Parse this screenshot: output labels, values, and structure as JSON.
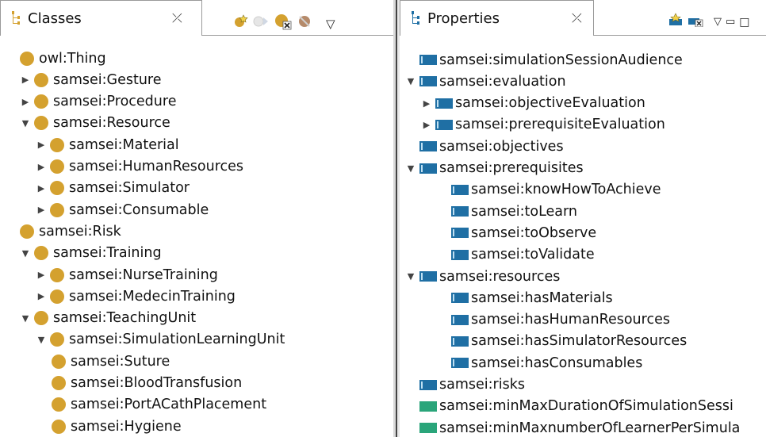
{
  "classes_view": {
    "title": "Classes",
    "close_glyph": "⤫",
    "toolbar_icons": [
      "add-subclass-icon",
      "add-sibling-icon",
      "delete-class-icon",
      "reason-icon",
      "view-menu-icon"
    ],
    "menu_glyph": "▽",
    "tree": [
      {
        "label": "owl:Thing",
        "depth": 0,
        "arrow": ""
      },
      {
        "label": "samsei:Gesture",
        "depth": 0,
        "arrow": "▶"
      },
      {
        "label": "samsei:Procedure",
        "depth": 0,
        "arrow": "▶"
      },
      {
        "label": "samsei:Resource",
        "depth": 0,
        "arrow": "▼"
      },
      {
        "label": "samsei:Material",
        "depth": 1,
        "arrow": "▶"
      },
      {
        "label": "samsei:HumanResources",
        "depth": 1,
        "arrow": "▶"
      },
      {
        "label": "samsei:Simulator",
        "depth": 1,
        "arrow": "▶"
      },
      {
        "label": "samsei:Consumable",
        "depth": 1,
        "arrow": "▶"
      },
      {
        "label": "samsei:Risk",
        "depth": 0,
        "arrow": ""
      },
      {
        "label": "samsei:Training",
        "depth": 0,
        "arrow": "▼"
      },
      {
        "label": "samsei:NurseTraining",
        "depth": 1,
        "arrow": "▶"
      },
      {
        "label": "samsei:MedecinTraining",
        "depth": 1,
        "arrow": "▶"
      },
      {
        "label": "samsei:TeachingUnit",
        "depth": 0,
        "arrow": "▼"
      },
      {
        "label": "samsei:SimulationLearningUnit",
        "depth": 1,
        "arrow": "▼"
      },
      {
        "label": "samsei:Suture",
        "depth": 2,
        "arrow": ""
      },
      {
        "label": "samsei:BloodTransfusion",
        "depth": 2,
        "arrow": ""
      },
      {
        "label": "samsei:PortACathPlacement",
        "depth": 2,
        "arrow": ""
      },
      {
        "label": "samsei:Hygiene",
        "depth": 2,
        "arrow": ""
      }
    ]
  },
  "properties_view": {
    "title": "Properties",
    "close_glyph": "⤫",
    "toolbar_icons": [
      "add-property-icon",
      "delete-property-icon",
      "view-menu-icon",
      "minimize-icon",
      "maximize-icon"
    ],
    "menu_glyph": "▽",
    "minimize_glyph": "▭",
    "maximize_glyph": "□",
    "tree": [
      {
        "label": "samsei:simulationSessionAudience",
        "depth": 0,
        "arrow": "",
        "kind": "object"
      },
      {
        "label": "samsei:evaluation",
        "depth": 0,
        "arrow": "▼",
        "kind": "object"
      },
      {
        "label": "samsei:objectiveEvaluation",
        "depth": 1,
        "arrow": "▶",
        "kind": "object"
      },
      {
        "label": "samsei:prerequisiteEvaluation",
        "depth": 1,
        "arrow": "▶",
        "kind": "object"
      },
      {
        "label": "samsei:objectives",
        "depth": 0,
        "arrow": "",
        "kind": "object"
      },
      {
        "label": "samsei:prerequisites",
        "depth": 0,
        "arrow": "▼",
        "kind": "object"
      },
      {
        "label": "samsei:knowHowToAchieve",
        "depth": 2,
        "arrow": "",
        "kind": "object"
      },
      {
        "label": "samsei:toLearn",
        "depth": 2,
        "arrow": "",
        "kind": "object"
      },
      {
        "label": "samsei:toObserve",
        "depth": 2,
        "arrow": "",
        "kind": "object"
      },
      {
        "label": "samsei:toValidate",
        "depth": 2,
        "arrow": "",
        "kind": "object"
      },
      {
        "label": "samsei:resources",
        "depth": 0,
        "arrow": "▼",
        "kind": "object"
      },
      {
        "label": "samsei:hasMaterials",
        "depth": 2,
        "arrow": "",
        "kind": "object"
      },
      {
        "label": "samsei:hasHumanResources",
        "depth": 2,
        "arrow": "",
        "kind": "object"
      },
      {
        "label": "samsei:hasSimulatorResources",
        "depth": 2,
        "arrow": "",
        "kind": "object"
      },
      {
        "label": "samsei:hasConsumables",
        "depth": 2,
        "arrow": "",
        "kind": "object"
      },
      {
        "label": "samsei:risks",
        "depth": 0,
        "arrow": "",
        "kind": "object"
      },
      {
        "label": "samsei:minMaxDurationOfSimulationSessi",
        "depth": 0,
        "arrow": "",
        "kind": "data"
      },
      {
        "label": "samsei:minMaxnumberOfLearnerPerSimula",
        "depth": 0,
        "arrow": "",
        "kind": "data"
      }
    ]
  },
  "colors": {
    "class_dot": "#d4a12f",
    "object_property": "#1f6fa4",
    "data_property": "#2aa57a"
  }
}
